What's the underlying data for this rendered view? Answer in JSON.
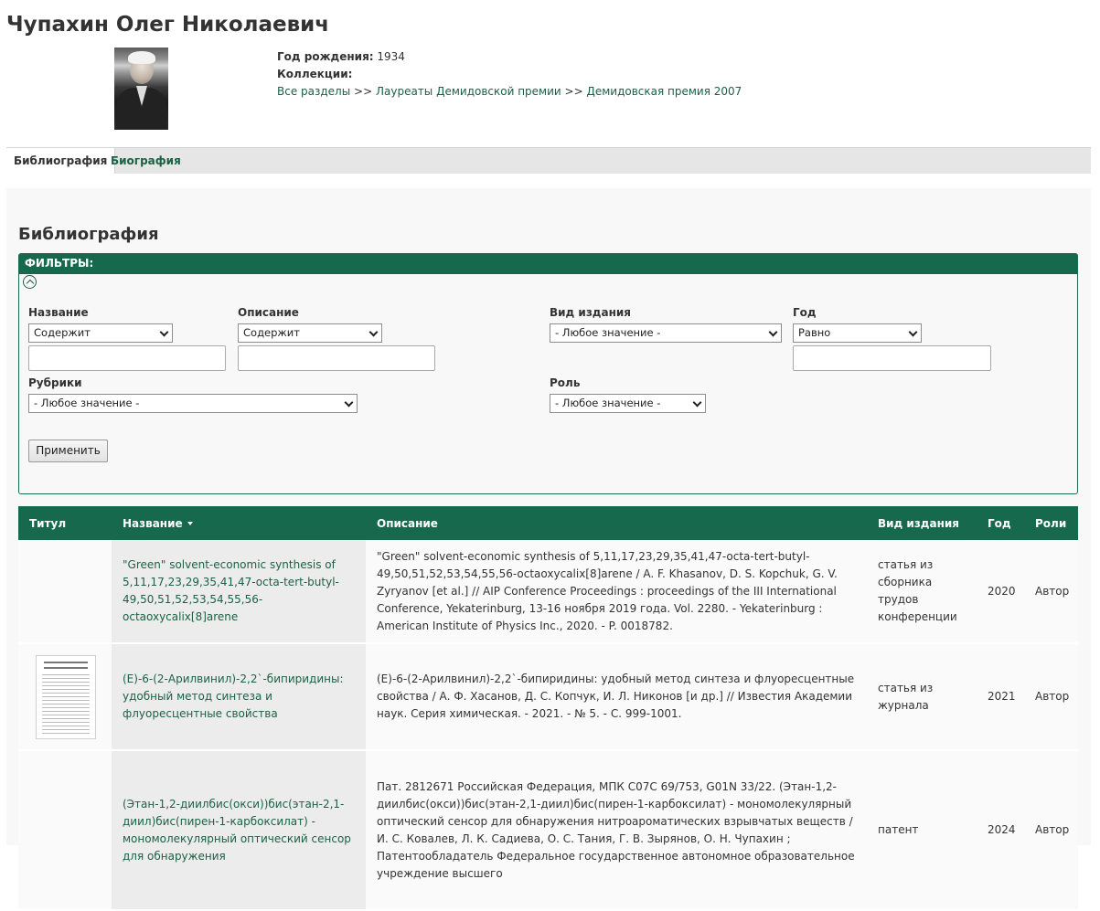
{
  "person": {
    "name": "Чупахин Олег Николаевич",
    "birth_label": "Год рождения:",
    "birth_year": "1934",
    "collections_label": "Коллекции:",
    "breadcrumb": [
      "Все разделы",
      "Лауреаты Демидовской премии",
      "Демидовская премия 2007"
    ],
    "separator": ">>"
  },
  "tabs": [
    {
      "label": "Библиография",
      "active": true
    },
    {
      "label": "Биография",
      "active": false
    }
  ],
  "section_title": "Библиография",
  "filters": {
    "header": "ФИЛЬТРЫ:",
    "name_label": "Название",
    "name_op": "Содержит",
    "desc_label": "Описание",
    "desc_op": "Содержит",
    "type_label": "Вид издания",
    "type_value": "- Любое значение -",
    "year_label": "Год",
    "year_op": "Равно",
    "rubric_label": "Рубрики",
    "rubric_value": "- Любое значение -",
    "role_label": "Роль",
    "role_value": "- Любое значение -",
    "apply_label": "Применить"
  },
  "table": {
    "columns": [
      "Титул",
      "Название",
      "Описание",
      "Вид издания",
      "Год",
      "Роли"
    ],
    "rows": [
      {
        "title": "\"Green\" solvent-economic synthesis of 5,11,17,23,29,35,41,47-octa-tert-butyl-49,50,51,52,53,54,55,56-octaoxycalix[8]arene",
        "description": "\"Green\" solvent-economic synthesis of 5,11,17,23,29,35,41,47-octa-tert-butyl-49,50,51,52,53,54,55,56-octaoxycalix[8]arene / A. F. Khasanov, D. S. Kopchuk, G. V. Zyryanov [et al.] // AIP Conference Proceedings : proceedings of the III International Conference, Yekaterinburg, 13-16 ноября 2019 года. Vol. 2280. - Yekaterinburg : American Institute of Physics Inc., 2020. - P. 0018782.",
        "type": "статья из сборника трудов конференции",
        "year": "2020",
        "role": "Автор"
      },
      {
        "title": "(E)-6-(2-Арилвинил)-2,2`-бипиридины: удобный метод синтеза и флуоресцентные свойства",
        "description": "(E)-6-(2-Арилвинил)-2,2`-бипиридины: удобный метод синтеза и флуоресцентные свойства / А. Ф. Хасанов, Д. С. Копчук, И. Л. Никонов [и др.] // Известия Академии наук. Серия химическая. - 2021. - № 5. - С. 999-1001.",
        "type": "статья из журнала",
        "year": "2021",
        "role": "Автор"
      },
      {
        "title": "(Этан-1,2-диилбис(окси))бис(этан-2,1-диил)бис(пирен-1-карбоксилат) - мономолекулярный оптический сенсор для обнаружения",
        "description": "Пат. 2812671 Российская Федерация, МПК C07C 69/753, G01N 33/22. (Этан-1,2-диилбис(окси))бис(этан-2,1-диил)бис(пирен-1-карбоксилат) - мономолекулярный оптический сенсор для обнаружения нитроароматических взрывчатых веществ / И. С. Ковалев, Л. К. Садиева, О. С. Тания, Г. В. Зырянов, О. Н. Чупахин ; Патентообладатель Федеральное государственное автономное образовательное учреждение высшего",
        "type": "патент",
        "year": "2024",
        "role": "Автор"
      }
    ]
  }
}
